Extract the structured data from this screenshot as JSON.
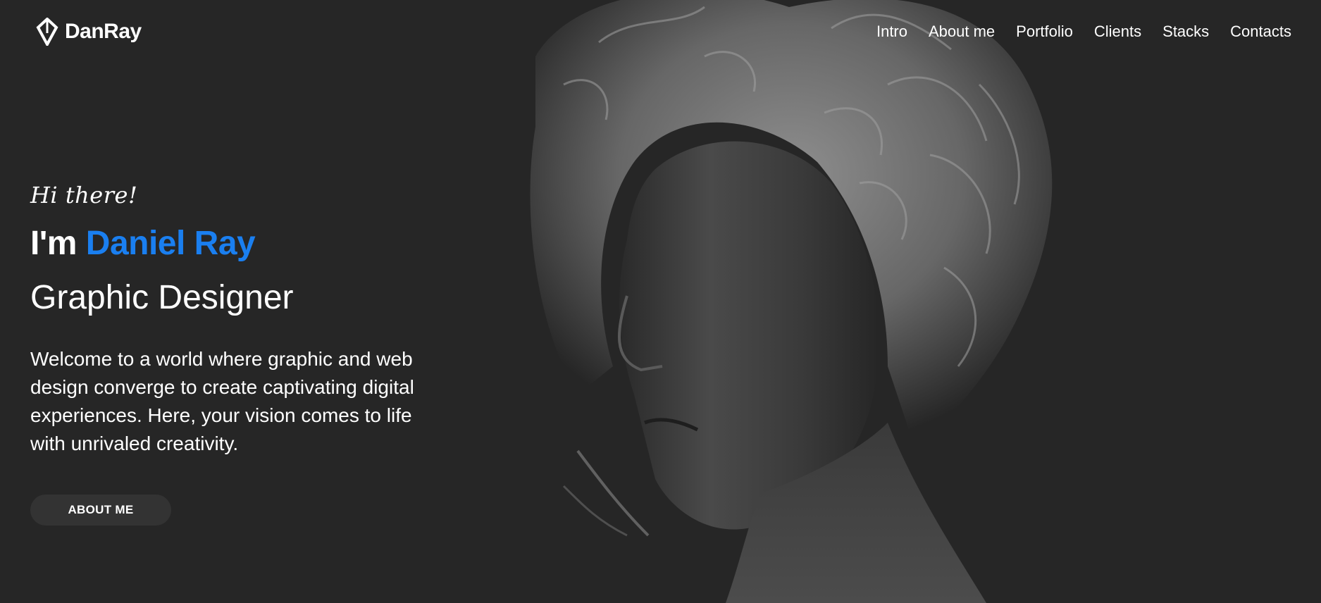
{
  "brand": {
    "name": "DanRay",
    "logo_icon": "diamond-logo-icon"
  },
  "nav": {
    "items": [
      {
        "label": "Intro"
      },
      {
        "label": "About me"
      },
      {
        "label": "Portfolio"
      },
      {
        "label": "Clients"
      },
      {
        "label": "Stacks"
      },
      {
        "label": "Contacts"
      }
    ]
  },
  "hero": {
    "greeting": "Hi there!",
    "headline_prefix": "I'm",
    "headline_name": "Daniel Ray",
    "role": "Graphic Designer",
    "intro": "Welcome to a world where graphic and web design converge to create captivating digital experiences. Here, your vision comes to life with unrivaled creativity.",
    "cta_label": "ABOUT ME"
  },
  "colors": {
    "background": "#262626",
    "accent": "#1a7ff0",
    "button": "#333333",
    "text": "#ffffff"
  }
}
